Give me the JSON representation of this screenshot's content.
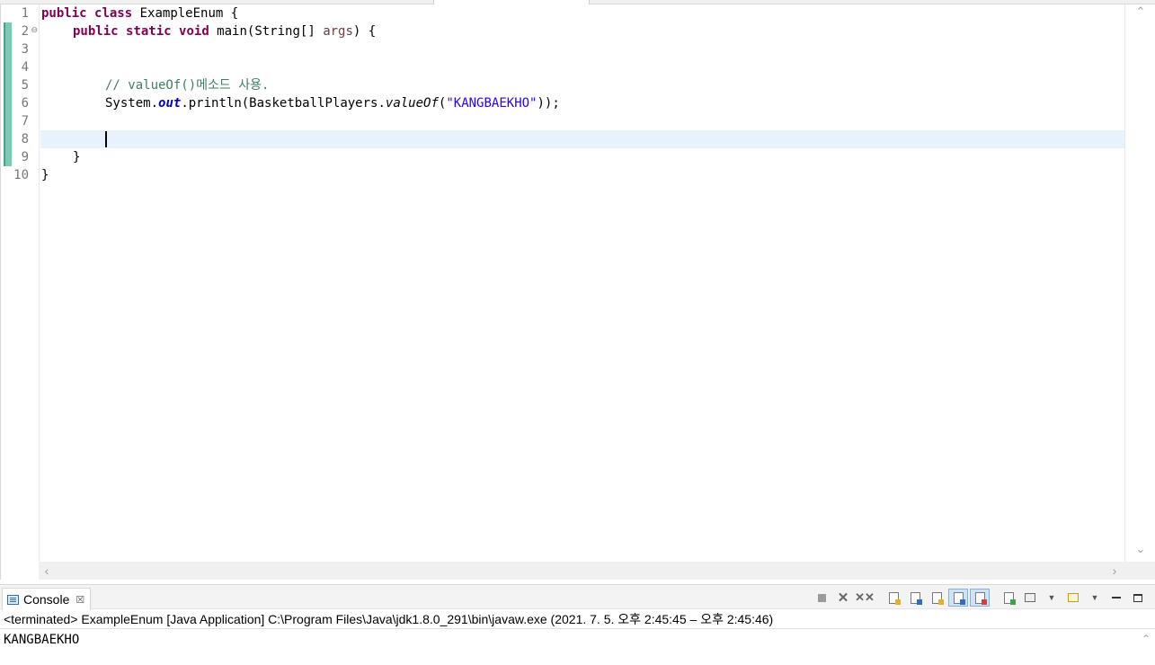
{
  "editor": {
    "line_numbers": [
      "1",
      "2",
      "3",
      "4",
      "5",
      "6",
      "7",
      "8",
      "9",
      "10"
    ],
    "fold_marker": "⊖",
    "lines": {
      "l1": {
        "kw1": "public",
        "kw2": "class",
        "rest": " ExampleEnum {"
      },
      "l2": {
        "kw1": "public",
        "kw2": "static",
        "kw3": "void",
        "rest1": " main(String[] ",
        "param": "args",
        "rest2": ") {"
      },
      "l5": {
        "comment": "// valueOf()메소드 사용."
      },
      "l6": {
        "pre": "System.",
        "field": "out",
        "mid": ".println(BasketballPlayers.",
        "method": "valueOf",
        "open": "(",
        "string": "\"KANGBAEKHO\"",
        "close": "));"
      },
      "l9": {
        "text": "}"
      },
      "l10": {
        "text": "}"
      }
    }
  },
  "console": {
    "tab_title": "Console",
    "tab_close": "☒",
    "description": "<terminated> ExampleEnum [Java Application] C:\\Program Files\\Java\\jdk1.8.0_291\\bin\\javaw.exe  (2021. 7. 5. 오후 2:45:45 – 오후 2:45:46)",
    "output": "KANGBAEKHO",
    "toolbar_icons": [
      "stop-icon",
      "remove-launch-icon",
      "remove-all-launches-icon",
      "clear-console-icon",
      "scroll-lock-icon",
      "word-wrap-icon",
      "show-on-stdout-icon",
      "show-on-stderr-icon",
      "pin-console-icon",
      "display-console-icon",
      "open-console-icon",
      "minimize-icon",
      "maximize-icon"
    ]
  },
  "colors": {
    "keyword": "#7f0055",
    "string": "#2a00ff",
    "comment": "#3f7f5f",
    "field": "#0000c0",
    "current_line": "#e8f2fe",
    "change_ruler": "#7ec8b6"
  }
}
